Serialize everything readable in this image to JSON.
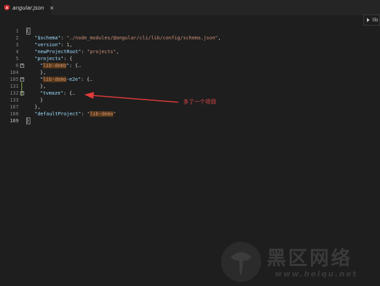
{
  "tabs": [
    {
      "label": "angular.json",
      "close": "×"
    }
  ],
  "peek_label": "lib",
  "gutter": {
    "line_numbers": [
      "1",
      "2",
      "3",
      "4",
      "5",
      "6",
      "104",
      "105",
      "131",
      "132",
      "133",
      "167",
      "168",
      "169",
      "170"
    ],
    "current_line": "170"
  },
  "code": {
    "l1": {
      "text": "{"
    },
    "l2": {
      "key": "\"$schema\"",
      "colon": ": ",
      "value": "\"./node_modules/@angular/cli/lib/config/schema.json\"",
      "end": ","
    },
    "l3": {
      "key": "\"version\"",
      "colon": ": ",
      "value": "1",
      "end": ","
    },
    "l4": {
      "key": "\"newProjectRoot\"",
      "colon": ": ",
      "value": "\"projects\"",
      "end": ","
    },
    "l5": {
      "key": "\"projects\"",
      "colon": ": ",
      "end": "{"
    },
    "l6": {
      "q1": "\"",
      "key": "lib-demo",
      "q2": "\"",
      "colon": ": {",
      "ellipsis": "…"
    },
    "l104": {
      "text": "},"
    },
    "l105": {
      "q1": "\"",
      "key": "lib-demo",
      "rest": "-e2e\"",
      "colon": ": {",
      "ellipsis": "…"
    },
    "l131": {
      "text": "},"
    },
    "l132": {
      "key": "\"tvmaze\"",
      "colon": ": {",
      "ellipsis": "…"
    },
    "l167": {
      "text": "}"
    },
    "l168": {
      "text": "},"
    },
    "l169": {
      "key": "\"defaultProject\"",
      "colon": ": ",
      "q1": "\"",
      "value": "lib-demo",
      "q2": "\""
    },
    "l170": {
      "text": "}"
    }
  },
  "annotation": {
    "text": "多了一个项目"
  },
  "watermark": {
    "title": "黑区网络",
    "url": "www.heiqu.net"
  }
}
